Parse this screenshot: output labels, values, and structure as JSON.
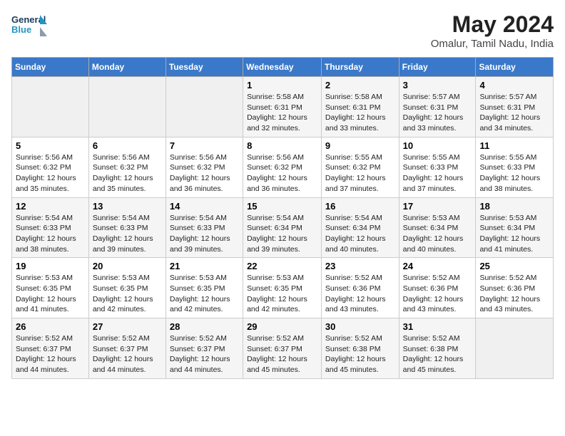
{
  "header": {
    "logo_line1": "General",
    "logo_line2": "Blue",
    "main_title": "May 2024",
    "subtitle": "Omalur, Tamil Nadu, India"
  },
  "weekdays": [
    "Sunday",
    "Monday",
    "Tuesday",
    "Wednesday",
    "Thursday",
    "Friday",
    "Saturday"
  ],
  "weeks": [
    [
      {
        "day": "",
        "info": ""
      },
      {
        "day": "",
        "info": ""
      },
      {
        "day": "",
        "info": ""
      },
      {
        "day": "1",
        "info": "Sunrise: 5:58 AM\nSunset: 6:31 PM\nDaylight: 12 hours\nand 32 minutes."
      },
      {
        "day": "2",
        "info": "Sunrise: 5:58 AM\nSunset: 6:31 PM\nDaylight: 12 hours\nand 33 minutes."
      },
      {
        "day": "3",
        "info": "Sunrise: 5:57 AM\nSunset: 6:31 PM\nDaylight: 12 hours\nand 33 minutes."
      },
      {
        "day": "4",
        "info": "Sunrise: 5:57 AM\nSunset: 6:31 PM\nDaylight: 12 hours\nand 34 minutes."
      }
    ],
    [
      {
        "day": "5",
        "info": "Sunrise: 5:56 AM\nSunset: 6:32 PM\nDaylight: 12 hours\nand 35 minutes."
      },
      {
        "day": "6",
        "info": "Sunrise: 5:56 AM\nSunset: 6:32 PM\nDaylight: 12 hours\nand 35 minutes."
      },
      {
        "day": "7",
        "info": "Sunrise: 5:56 AM\nSunset: 6:32 PM\nDaylight: 12 hours\nand 36 minutes."
      },
      {
        "day": "8",
        "info": "Sunrise: 5:56 AM\nSunset: 6:32 PM\nDaylight: 12 hours\nand 36 minutes."
      },
      {
        "day": "9",
        "info": "Sunrise: 5:55 AM\nSunset: 6:32 PM\nDaylight: 12 hours\nand 37 minutes."
      },
      {
        "day": "10",
        "info": "Sunrise: 5:55 AM\nSunset: 6:33 PM\nDaylight: 12 hours\nand 37 minutes."
      },
      {
        "day": "11",
        "info": "Sunrise: 5:55 AM\nSunset: 6:33 PM\nDaylight: 12 hours\nand 38 minutes."
      }
    ],
    [
      {
        "day": "12",
        "info": "Sunrise: 5:54 AM\nSunset: 6:33 PM\nDaylight: 12 hours\nand 38 minutes."
      },
      {
        "day": "13",
        "info": "Sunrise: 5:54 AM\nSunset: 6:33 PM\nDaylight: 12 hours\nand 39 minutes."
      },
      {
        "day": "14",
        "info": "Sunrise: 5:54 AM\nSunset: 6:33 PM\nDaylight: 12 hours\nand 39 minutes."
      },
      {
        "day": "15",
        "info": "Sunrise: 5:54 AM\nSunset: 6:34 PM\nDaylight: 12 hours\nand 39 minutes."
      },
      {
        "day": "16",
        "info": "Sunrise: 5:54 AM\nSunset: 6:34 PM\nDaylight: 12 hours\nand 40 minutes."
      },
      {
        "day": "17",
        "info": "Sunrise: 5:53 AM\nSunset: 6:34 PM\nDaylight: 12 hours\nand 40 minutes."
      },
      {
        "day": "18",
        "info": "Sunrise: 5:53 AM\nSunset: 6:34 PM\nDaylight: 12 hours\nand 41 minutes."
      }
    ],
    [
      {
        "day": "19",
        "info": "Sunrise: 5:53 AM\nSunset: 6:35 PM\nDaylight: 12 hours\nand 41 minutes."
      },
      {
        "day": "20",
        "info": "Sunrise: 5:53 AM\nSunset: 6:35 PM\nDaylight: 12 hours\nand 42 minutes."
      },
      {
        "day": "21",
        "info": "Sunrise: 5:53 AM\nSunset: 6:35 PM\nDaylight: 12 hours\nand 42 minutes."
      },
      {
        "day": "22",
        "info": "Sunrise: 5:53 AM\nSunset: 6:35 PM\nDaylight: 12 hours\nand 42 minutes."
      },
      {
        "day": "23",
        "info": "Sunrise: 5:52 AM\nSunset: 6:36 PM\nDaylight: 12 hours\nand 43 minutes."
      },
      {
        "day": "24",
        "info": "Sunrise: 5:52 AM\nSunset: 6:36 PM\nDaylight: 12 hours\nand 43 minutes."
      },
      {
        "day": "25",
        "info": "Sunrise: 5:52 AM\nSunset: 6:36 PM\nDaylight: 12 hours\nand 43 minutes."
      }
    ],
    [
      {
        "day": "26",
        "info": "Sunrise: 5:52 AM\nSunset: 6:37 PM\nDaylight: 12 hours\nand 44 minutes."
      },
      {
        "day": "27",
        "info": "Sunrise: 5:52 AM\nSunset: 6:37 PM\nDaylight: 12 hours\nand 44 minutes."
      },
      {
        "day": "28",
        "info": "Sunrise: 5:52 AM\nSunset: 6:37 PM\nDaylight: 12 hours\nand 44 minutes."
      },
      {
        "day": "29",
        "info": "Sunrise: 5:52 AM\nSunset: 6:37 PM\nDaylight: 12 hours\nand 45 minutes."
      },
      {
        "day": "30",
        "info": "Sunrise: 5:52 AM\nSunset: 6:38 PM\nDaylight: 12 hours\nand 45 minutes."
      },
      {
        "day": "31",
        "info": "Sunrise: 5:52 AM\nSunset: 6:38 PM\nDaylight: 12 hours\nand 45 minutes."
      },
      {
        "day": "",
        "info": ""
      }
    ]
  ]
}
